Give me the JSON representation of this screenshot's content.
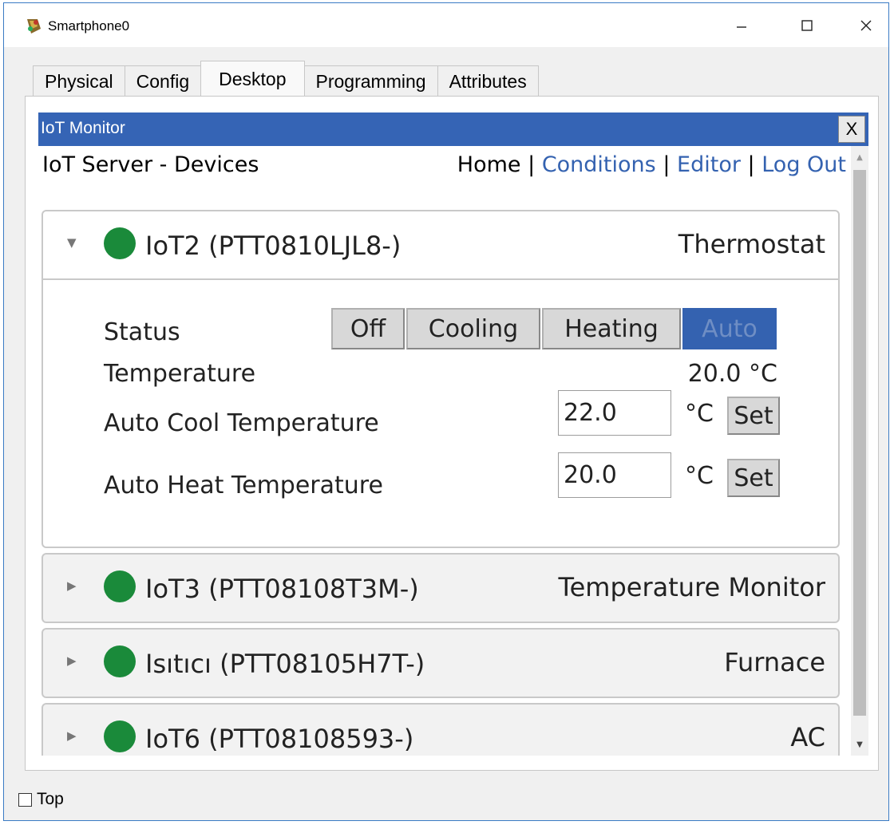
{
  "window": {
    "title": "Smartphone0"
  },
  "tabs": [
    {
      "label": "Physical",
      "active": false
    },
    {
      "label": "Config",
      "active": false
    },
    {
      "label": "Desktop",
      "active": true
    },
    {
      "label": "Programming",
      "active": false
    },
    {
      "label": "Attributes",
      "active": false
    }
  ],
  "iot_monitor": {
    "title": "IoT Monitor",
    "close_label": "X"
  },
  "page": {
    "heading": "IoT Server - Devices",
    "nav": {
      "home": "Home",
      "sep": "|",
      "conditions": "Conditions",
      "editor": "Editor",
      "logout": "Log Out"
    }
  },
  "devices": [
    {
      "name": "IoT2 (PTT0810LJL8-)",
      "type": "Thermostat",
      "expanded": true,
      "status_label": "Status",
      "status_options": [
        "Off",
        "Cooling",
        "Heating",
        "Auto"
      ],
      "status_selected": "Auto",
      "temperature_label": "Temperature",
      "temperature_value": "20.0 °C",
      "auto_cool_label": "Auto Cool Temperature",
      "auto_cool_value": "22.0",
      "auto_heat_label": "Auto Heat Temperature",
      "auto_heat_value": "20.0",
      "unit": "°C",
      "set_label": "Set"
    },
    {
      "name": "IoT3 (PTT08108T3M-)",
      "type": "Temperature Monitor",
      "expanded": false
    },
    {
      "name": "Isıtıcı (PTT08105H7T-)",
      "type": "Furnace",
      "expanded": false
    },
    {
      "name": "IoT6 (PTT08108593-)",
      "type": "AC",
      "expanded": false
    }
  ],
  "status_color": "#1a8a3a",
  "accent_color": "#3462b0",
  "footer": {
    "top_checkbox_label": "Top",
    "top_checked": false
  }
}
